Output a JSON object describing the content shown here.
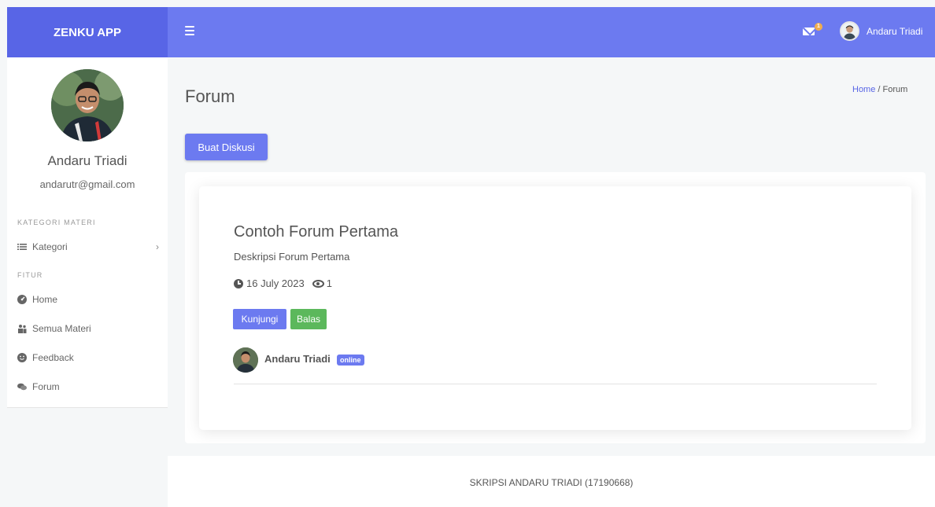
{
  "brand": {
    "name": "ZENKU APP"
  },
  "topbar": {
    "mail_count": "1",
    "user_name": "Andaru Triadi"
  },
  "sidebar": {
    "user_name": "Andaru Triadi",
    "user_email": "andarutr@gmail.com",
    "section_materi": "KATEGORI MATERI",
    "section_fitur": "FITUR",
    "items": [
      {
        "label": "Kategori",
        "icon": "list-icon"
      },
      {
        "label": "Home",
        "icon": "dashboard-icon"
      },
      {
        "label": "Semua Materi",
        "icon": "users-icon"
      },
      {
        "label": "Feedback",
        "icon": "smile-icon"
      },
      {
        "label": "Forum",
        "icon": "comments-icon"
      }
    ]
  },
  "page": {
    "title": "Forum",
    "breadcrumb_home": "Home",
    "breadcrumb_sep": "/",
    "breadcrumb_current": "Forum",
    "create_button": "Buat Diskusi"
  },
  "forum": {
    "title": "Contoh Forum Pertama",
    "description": "Deskripsi Forum Pertama",
    "date": "16 July 2023",
    "views": "1",
    "visit_button": "Kunjungi",
    "reply_button": "Balas",
    "author": "Andaru Triadi",
    "status": "online"
  },
  "footer": {
    "text": "SKRIPSI ANDARU TRIADI (17190668)"
  },
  "colors": {
    "primary": "#6c7af0",
    "brand": "#5865e6",
    "success": "#5cb85c",
    "badge": "#f0ad4e"
  }
}
